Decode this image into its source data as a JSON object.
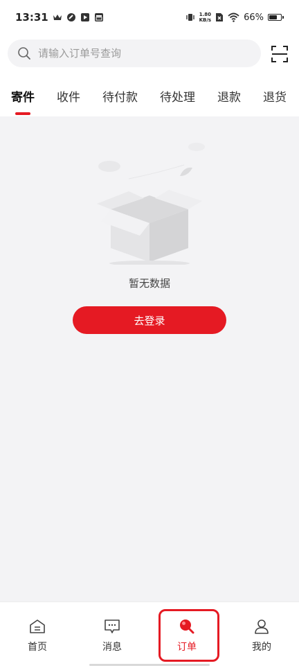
{
  "status_bar": {
    "time": "13:31",
    "net_speed_value": "1.80",
    "net_speed_unit": "KB/s",
    "battery": "66%",
    "battery_level": 0.66
  },
  "search": {
    "placeholder": "请输入订单号查询"
  },
  "tabs": [
    {
      "label": "寄件",
      "active": true
    },
    {
      "label": "收件"
    },
    {
      "label": "待付款"
    },
    {
      "label": "待处理"
    },
    {
      "label": "退款"
    },
    {
      "label": "退货"
    }
  ],
  "empty_state": {
    "message": "暂无数据",
    "login_button": "去登录"
  },
  "bottom_nav": [
    {
      "label": "首页",
      "icon": "home-icon"
    },
    {
      "label": "消息",
      "icon": "message-icon"
    },
    {
      "label": "订单",
      "icon": "order-search-icon",
      "active": true
    },
    {
      "label": "我的",
      "icon": "profile-icon"
    }
  ],
  "colors": {
    "accent": "#e51a23",
    "background": "#f3f3f5"
  }
}
